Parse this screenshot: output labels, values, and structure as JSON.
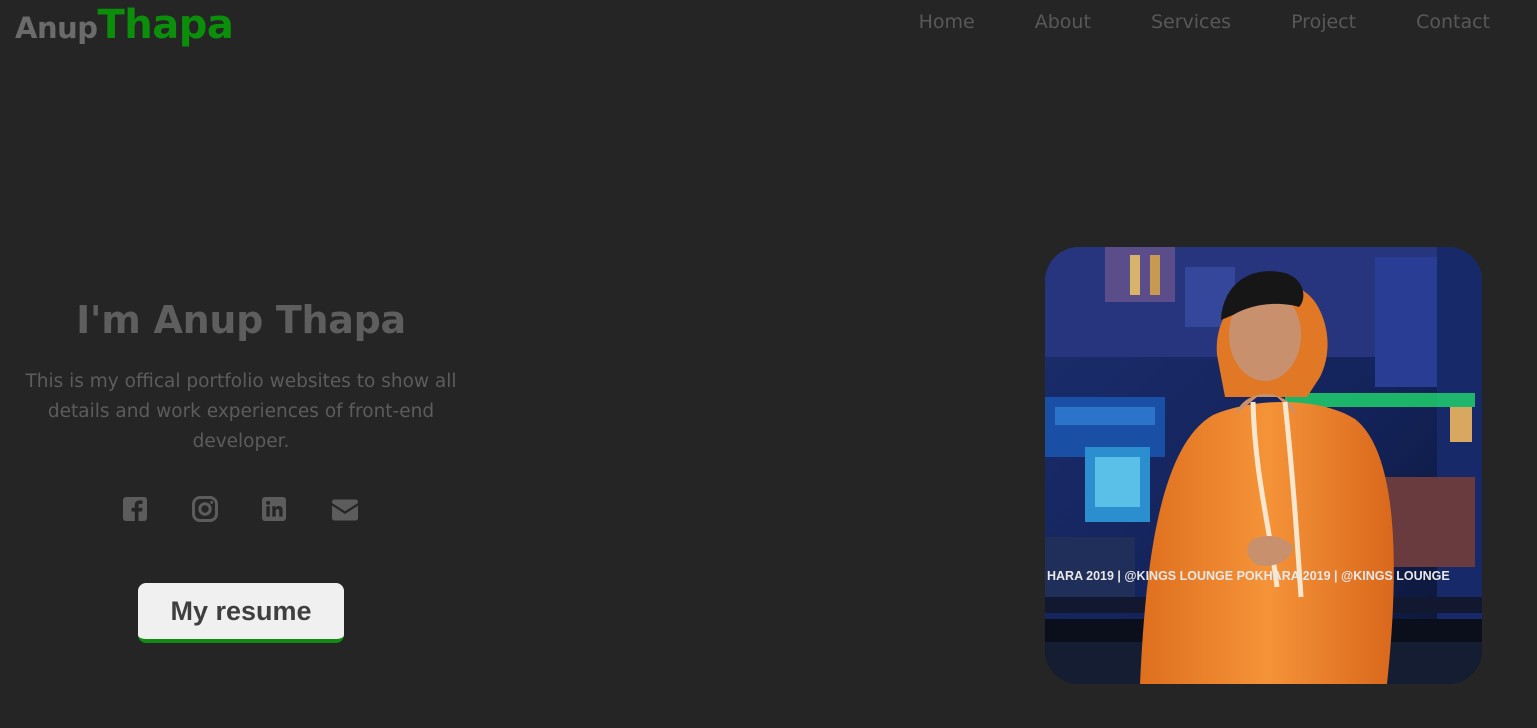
{
  "brand": {
    "first": "Anup",
    "last": "Thapa"
  },
  "nav": {
    "items": [
      {
        "label": "Home"
      },
      {
        "label": "About"
      },
      {
        "label": "Services"
      },
      {
        "label": "Project"
      },
      {
        "label": "Contact"
      }
    ]
  },
  "hero": {
    "title": "I'm Anup Thapa",
    "description": "This is my offical portfolio websites to show all details and work experiences of front-end developer.",
    "resume_label": "My resume"
  },
  "socials": [
    {
      "icon": "facebook-icon"
    },
    {
      "icon": "instagram-icon"
    },
    {
      "icon": "linkedin-icon"
    },
    {
      "icon": "envelope-icon"
    }
  ],
  "photo": {
    "caption": "HARA 2019 |  @KINGS LOUNGE POKHARA 2019 |  @KINGS LOUNGE"
  },
  "colors": {
    "background": "#252525",
    "accent": "#0b8f0b",
    "muted_text": "#5e5e5e",
    "hoodie": "#f08a30"
  }
}
